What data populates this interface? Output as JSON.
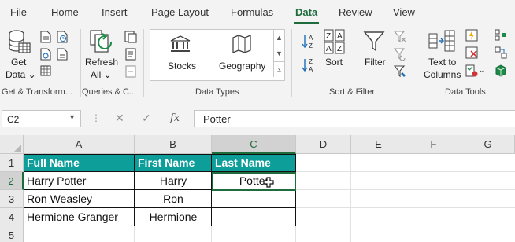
{
  "tabs": [
    "File",
    "Home",
    "Insert",
    "Page Layout",
    "Formulas",
    "Data",
    "Review",
    "View"
  ],
  "active_tab": "Data",
  "ribbon": {
    "get_data_line1": "Get",
    "get_data_line2": "Data ⌄",
    "refresh_line1": "Refresh",
    "refresh_line2": "All ⌄",
    "stocks": "Stocks",
    "geography": "Geography",
    "sort": "Sort",
    "filter": "Filter",
    "text_to_line1": "Text to",
    "text_to_line2": "Columns",
    "groups": {
      "get_transform": "Get & Transform...",
      "queries": "Queries & C...",
      "data_types": "Data Types",
      "sort_filter": "Sort & Filter",
      "data_tools": "Data Tools"
    }
  },
  "formula_bar": {
    "name_box": "C2",
    "formula": "Potter"
  },
  "grid": {
    "columns": [
      "A",
      "B",
      "C",
      "D",
      "E",
      "F",
      "G"
    ],
    "rows": [
      "1",
      "2",
      "3",
      "4",
      "5"
    ],
    "header": [
      "Full Name",
      "First Name",
      "Last Name"
    ],
    "data": [
      [
        "Harry Potter",
        "Harry",
        "Potter"
      ],
      [
        "Ron Weasley",
        "Ron",
        ""
      ],
      [
        "Hermione Granger",
        "Hermione",
        ""
      ]
    ]
  },
  "colors": {
    "accent": "#1e6b3c",
    "table_header": "#0e9e9a"
  }
}
